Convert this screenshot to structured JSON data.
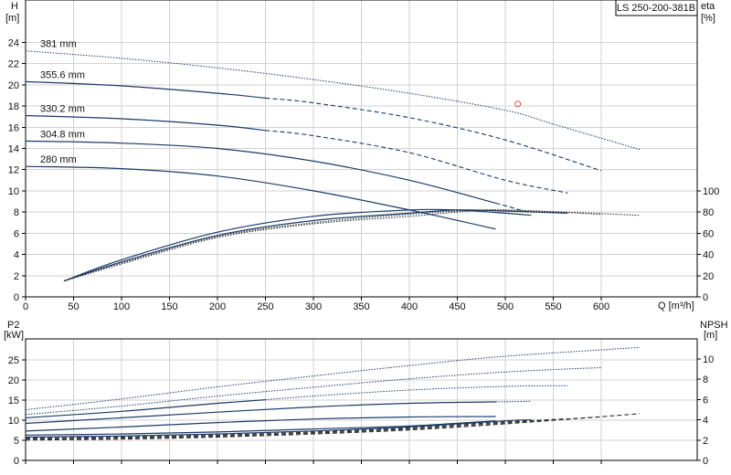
{
  "product_label": "LS 250-200-381B",
  "top_chart": {
    "y_left_label": "H",
    "y_left_unit": "[m]",
    "y_right_label": "eta",
    "y_right_unit": "[%]",
    "x_label": "Q [m³/h]",
    "x_ticks": [
      0,
      50,
      100,
      150,
      200,
      250,
      300,
      350,
      400,
      450,
      500,
      550,
      600
    ],
    "y_left_ticks": [
      0,
      2,
      4,
      6,
      8,
      10,
      12,
      14,
      16,
      18,
      20,
      22,
      24
    ],
    "y_right_ticks": [
      0,
      20,
      40,
      60,
      80,
      100
    ]
  },
  "bottom_chart": {
    "y_left_label": "P2",
    "y_left_unit": "[kW]",
    "y_right_label": "NPSH",
    "y_right_unit": "[m]",
    "y_left_ticks": [
      0,
      5,
      10,
      15,
      20,
      25
    ],
    "y_right_ticks": [
      0,
      2,
      4,
      6,
      8,
      10
    ]
  },
  "chart_data": [
    {
      "type": "line",
      "xlim": [
        0,
        700
      ],
      "ylim": [
        0,
        24
      ],
      "y2lim": [
        0,
        100
      ],
      "series": [
        {
          "name": "381 mm",
          "axis": "H",
          "x": [
            0,
            100,
            200,
            300,
            400,
            500,
            550,
            640
          ],
          "y": [
            23.2,
            22.5,
            21.6,
            20.5,
            19.2,
            17.6,
            16.3,
            13.9
          ]
        },
        {
          "name": "355.6 mm",
          "axis": "H",
          "x": [
            0,
            100,
            200,
            300,
            400,
            500,
            600
          ],
          "y": [
            20.3,
            19.9,
            19.2,
            18.3,
            16.9,
            14.8,
            11.9
          ]
        },
        {
          "name": "330.2 mm",
          "axis": "H",
          "x": [
            0,
            100,
            200,
            300,
            400,
            500,
            565
          ],
          "y": [
            17.1,
            16.8,
            16.2,
            15.2,
            13.6,
            11.0,
            9.8
          ]
        },
        {
          "name": "304.8 mm",
          "axis": "H",
          "x": [
            0,
            100,
            200,
            300,
            400,
            500,
            527
          ],
          "y": [
            14.7,
            14.5,
            14.0,
            12.8,
            11.0,
            8.6,
            7.9
          ]
        },
        {
          "name": "280 mm",
          "axis": "H",
          "x": [
            0,
            100,
            200,
            300,
            400,
            490
          ],
          "y": [
            12.3,
            12.1,
            11.4,
            10.0,
            8.2,
            6.4
          ]
        },
        {
          "axis": "eta",
          "x": [
            40,
            100,
            200,
            300,
            400,
            450,
            500,
            527
          ],
          "y": [
            15,
            35,
            61,
            76,
            82,
            82,
            79,
            77
          ]
        },
        {
          "axis": "eta",
          "x": [
            40,
            100,
            200,
            300,
            400,
            450,
            500,
            565
          ],
          "y": [
            15,
            33,
            58,
            72,
            79,
            82,
            81,
            79
          ]
        },
        {
          "axis": "eta",
          "x": [
            40,
            100,
            200,
            300,
            400,
            450,
            500,
            600
          ],
          "y": [
            15,
            32,
            57,
            70,
            78,
            81,
            82,
            78
          ]
        },
        {
          "axis": "eta",
          "x": [
            40,
            100,
            200,
            300,
            400,
            450,
            500,
            640
          ],
          "y": [
            15,
            31,
            56,
            69,
            76,
            80,
            82,
            77
          ]
        }
      ],
      "annotations": [
        {
          "type": "marker",
          "x": 513,
          "y": 18.2
        }
      ]
    },
    {
      "type": "line",
      "xlim": [
        0,
        700
      ],
      "ylim": [
        0,
        30
      ],
      "y2lim": [
        0,
        12
      ],
      "series": [
        {
          "axis": "P2",
          "x": [
            0,
            100,
            200,
            300,
            400,
            490
          ],
          "y": [
            7.3,
            8.3,
            9.4,
            10.3,
            10.8,
            10.9
          ]
        },
        {
          "axis": "P2",
          "x": [
            0,
            100,
            200,
            300,
            400,
            500,
            527
          ],
          "y": [
            9.2,
            10.6,
            12.0,
            13.3,
            14.2,
            14.6,
            14.7
          ]
        },
        {
          "axis": "P2",
          "x": [
            0,
            100,
            200,
            300,
            400,
            500,
            565
          ],
          "y": [
            10.6,
            12.2,
            14.2,
            16.0,
            17.5,
            18.4,
            18.6
          ]
        },
        {
          "axis": "P2",
          "x": [
            0,
            100,
            200,
            300,
            400,
            500,
            600
          ],
          "y": [
            11.4,
            13.5,
            16.0,
            18.2,
            20.3,
            22.0,
            23.1
          ]
        },
        {
          "axis": "P2",
          "x": [
            0,
            100,
            200,
            300,
            400,
            500,
            640
          ],
          "y": [
            12.6,
            15.3,
            18.3,
            21.0,
            23.6,
            25.9,
            28.1
          ]
        },
        {
          "axis": "NPSH",
          "x": [
            0,
            100,
            200,
            300,
            400,
            490
          ],
          "y": [
            2.5,
            2.6,
            2.8,
            3.1,
            3.4,
            3.9
          ]
        },
        {
          "axis": "NPSH",
          "x": [
            0,
            100,
            200,
            300,
            400,
            500,
            527
          ],
          "y": [
            2.3,
            2.4,
            2.6,
            2.9,
            3.3,
            3.9,
            4.0
          ]
        },
        {
          "axis": "NPSH",
          "x": [
            0,
            100,
            200,
            300,
            400,
            500,
            565
          ],
          "y": [
            2.2,
            2.3,
            2.5,
            2.8,
            3.2,
            3.8,
            4.1
          ]
        },
        {
          "axis": "NPSH",
          "x": [
            0,
            100,
            200,
            300,
            400,
            500,
            600
          ],
          "y": [
            2.1,
            2.2,
            2.4,
            2.7,
            3.1,
            3.7,
            4.3
          ]
        },
        {
          "axis": "NPSH",
          "x": [
            0,
            100,
            200,
            300,
            400,
            500,
            640
          ],
          "y": [
            2.0,
            2.1,
            2.3,
            2.6,
            3.0,
            3.6,
            4.6
          ]
        }
      ]
    }
  ],
  "colors": {
    "head": "#1b3a68",
    "efficiency": "#222222",
    "npsh": "#333333",
    "grid": "#d2d2d2",
    "marker": "#e05050"
  }
}
